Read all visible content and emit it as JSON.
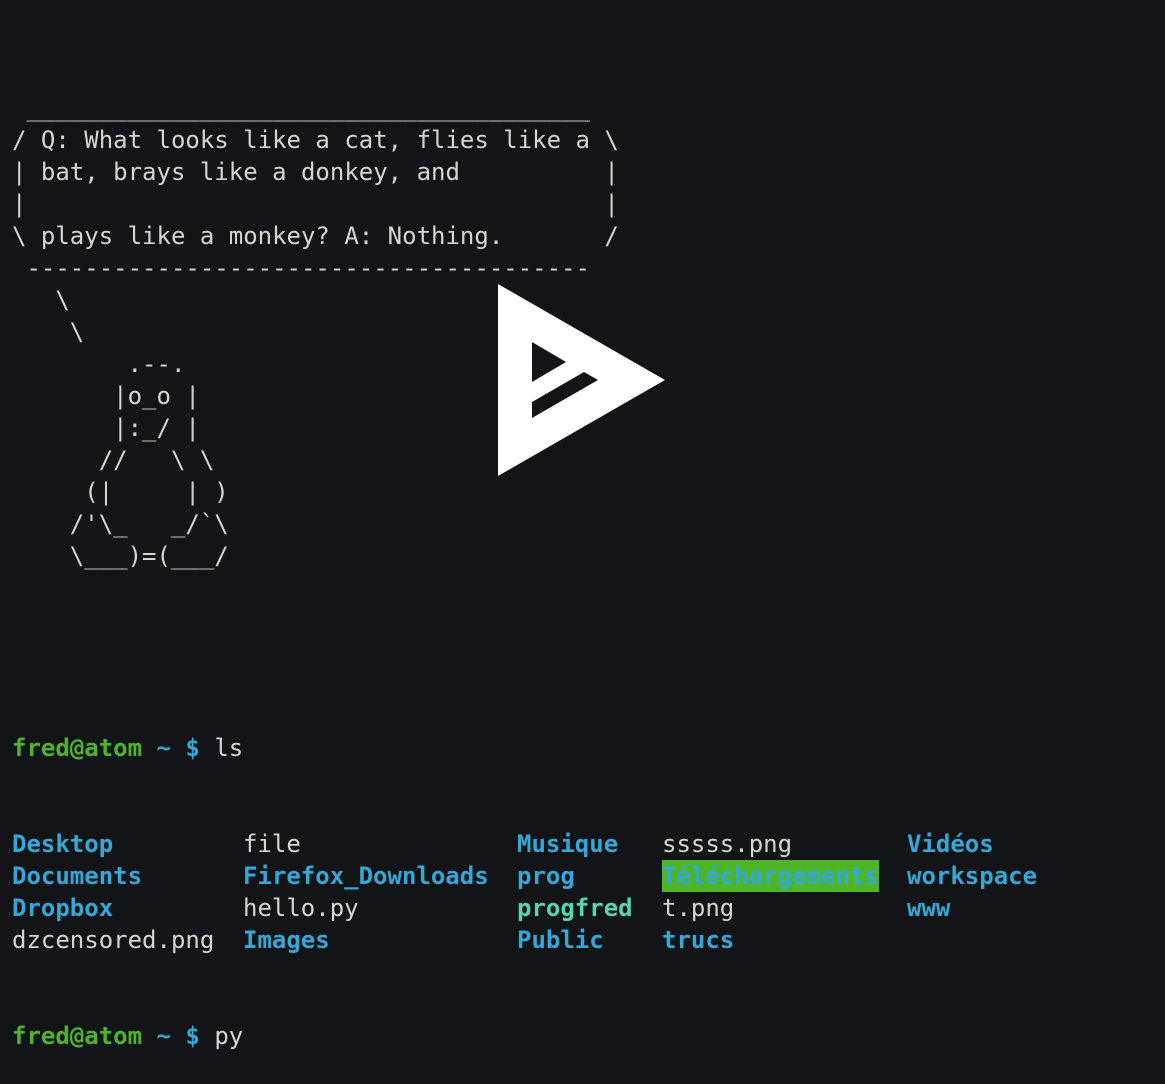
{
  "cowsay": {
    "lines": [
      " _______________________________________",
      "/ Q: What looks like a cat, flies like a \\",
      "| bat, brays like a donkey, and          |",
      "|                                        |",
      "\\ plays like a monkey? A: Nothing.       /",
      " ---------------------------------------",
      "   \\",
      "    \\",
      "        .--.",
      "       |o_o |",
      "       |:_/ |",
      "      //   \\ \\",
      "     (|     | )",
      "    /'\\_   _/`\\",
      "    \\___)=(___/"
    ]
  },
  "prompt": {
    "user_host": "fred@atom",
    "path": "~",
    "symbol": "$"
  },
  "commands": {
    "first": "ls",
    "second": "py"
  },
  "listing": {
    "col1": [
      {
        "name": "Desktop",
        "type": "dir"
      },
      {
        "name": "Documents",
        "type": "dir"
      },
      {
        "name": "Dropbox",
        "type": "dir"
      },
      {
        "name": "dzcensored.png",
        "type": "file"
      }
    ],
    "col2": [
      {
        "name": "file",
        "type": "file"
      },
      {
        "name": "Firefox_Downloads",
        "type": "dir"
      },
      {
        "name": "hello.py",
        "type": "file"
      },
      {
        "name": "Images",
        "type": "dir"
      }
    ],
    "col3": [
      {
        "name": "Musique",
        "type": "dir"
      },
      {
        "name": "prog",
        "type": "dir"
      },
      {
        "name": "progfred",
        "type": "exec"
      },
      {
        "name": "Public",
        "type": "dir"
      }
    ],
    "col4": [
      {
        "name": "sssss.png",
        "type": "file"
      },
      {
        "name": "Téléchargements",
        "type": "highlight"
      },
      {
        "name": "t.png",
        "type": "file"
      },
      {
        "name": "trucs",
        "type": "dir"
      }
    ],
    "col5": [
      {
        "name": "Vidéos",
        "type": "dir"
      },
      {
        "name": "workspace",
        "type": "dir"
      },
      {
        "name": "www",
        "type": "dir"
      }
    ]
  },
  "overlay": {
    "icon": "play-logo-icon"
  }
}
